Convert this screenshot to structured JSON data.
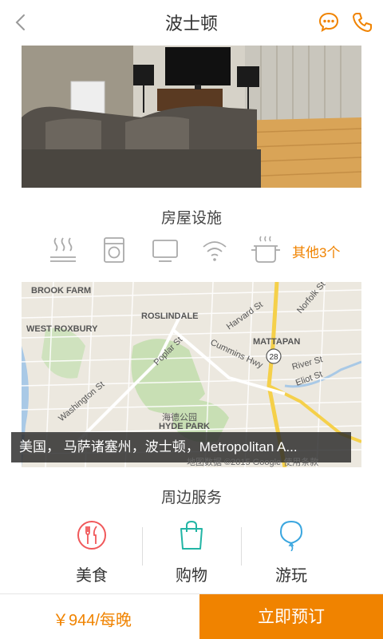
{
  "header": {
    "title": "波士顿",
    "back_icon": "chevron-left-icon",
    "chat_icon": "chat-bubble-icon",
    "phone_icon": "phone-icon"
  },
  "facilities": {
    "title": "房屋设施",
    "icons": [
      "heater-icon",
      "washing-machine-icon",
      "tv-icon",
      "wifi-icon",
      "cooking-pot-icon"
    ],
    "others_label": "其他3个"
  },
  "map": {
    "address": "美国， 马萨诸塞州，波士顿，Metropolitan A...",
    "credit": "地图数据 ©2015 Google   使用条款",
    "labels": [
      "BROOK FARM",
      "WEST ROXBURY",
      "ROSLINDALE",
      "MATTAPAN",
      "HYDE PARK",
      "海德公园",
      "Washington St",
      "Poplar St",
      "Cummins Hwy",
      "Harvard St",
      "River St",
      "Eliot St",
      "Norfolk St",
      "28"
    ]
  },
  "services": {
    "title": "周边服务",
    "items": [
      {
        "label": "美食",
        "icon": "food-icon"
      },
      {
        "label": "购物",
        "icon": "shopping-bag-icon"
      },
      {
        "label": "游玩",
        "icon": "balloon-icon"
      }
    ]
  },
  "bottom": {
    "price": "￥944/每晚",
    "book_label": "立即预订"
  },
  "colors": {
    "accent": "#f08300",
    "service_food": "#f0585a",
    "service_shopping": "#22b5a5",
    "service_play": "#3aa6df"
  }
}
